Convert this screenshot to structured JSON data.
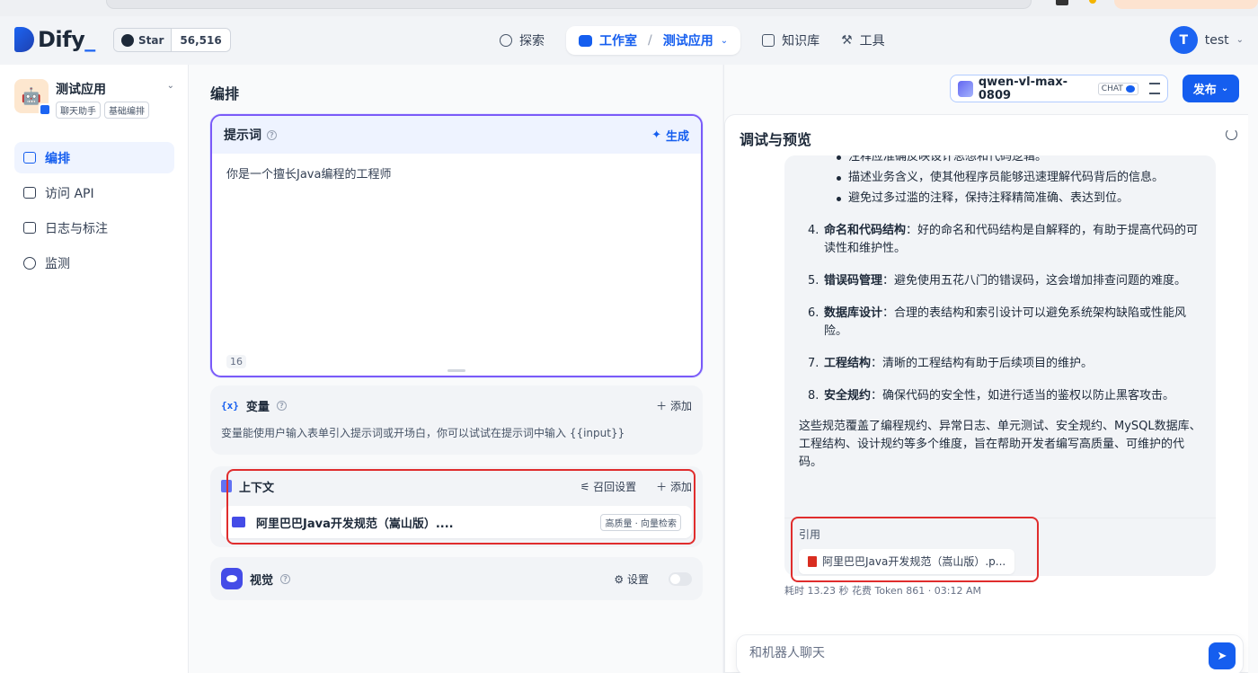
{
  "topnav": {
    "logo": "Dify",
    "github": {
      "star_label": "Star",
      "star_count": "56,516"
    },
    "nav": {
      "explore": "探索",
      "studio": "工作室",
      "current_app": "测试应用",
      "knowledge": "知识库",
      "tools": "工具"
    },
    "user": {
      "initial": "T",
      "name": "test"
    }
  },
  "sidebar": {
    "app": {
      "name": "测试应用",
      "tags": [
        "聊天助手",
        "基础编排"
      ]
    },
    "items": [
      {
        "label": "编排",
        "icon": "layout-icon",
        "active": true
      },
      {
        "label": "访问 API",
        "icon": "terminal-icon",
        "active": false
      },
      {
        "label": "日志与标注",
        "icon": "document-icon",
        "active": false
      },
      {
        "label": "监测",
        "icon": "monitor-icon",
        "active": false
      }
    ]
  },
  "orchestrate": {
    "title": "编排",
    "prompt": {
      "label": "提示词",
      "generate": "生成",
      "content": "你是一个擅长Java编程的工程师",
      "char_count": "16"
    },
    "variables": {
      "label": "变量",
      "add": "添加",
      "description": "变量能使用户输入表单引入提示词或开场白，你可以试试在提示词中输入 {{input}}"
    },
    "context": {
      "label": "上下文",
      "recall_settings": "召回设置",
      "add": "添加",
      "dataset_name": "阿里巴巴Java开发规范（嵩山版）....",
      "dataset_badge": "高质量 · 向量检索"
    },
    "vision": {
      "label": "视觉",
      "settings": "设置",
      "enabled": false
    }
  },
  "model": {
    "name": "qwen-vl-max-0809",
    "mode_badge": "CHAT"
  },
  "publish_label": "发布",
  "debug": {
    "title": "调试与预览",
    "bullets": [
      "注释应准确反映设计思想和代码逻辑。",
      "描述业务含义，使其他程序员能够迅速理解代码背后的信息。",
      "避免过多过滥的注释，保持注释精简准确、表达到位。"
    ],
    "items": [
      {
        "num": "4.",
        "title": "命名和代码结构",
        "text": "：好的命名和代码结构是自解释的，有助于提高代码的可读性和维护性。"
      },
      {
        "num": "5.",
        "title": "错误码管理",
        "text": "：避免使用五花八门的错误码，这会增加排查问题的难度。"
      },
      {
        "num": "6.",
        "title": "数据库设计",
        "text": "：合理的表结构和索引设计可以避免系统架构缺陷或性能风险。"
      },
      {
        "num": "7.",
        "title": "工程结构",
        "text": "：清晰的工程结构有助于后续项目的维护。"
      },
      {
        "num": "8.",
        "title": "安全规约",
        "text": "：确保代码的安全性，如进行适当的鉴权以防止黑客攻击。"
      }
    ],
    "summary": "这些规范覆盖了编程规约、异常日志、单元测试、安全规约、MySQL数据库、工程结构、设计规约等多个维度，旨在帮助开发者编写高质量、可维护的代码。",
    "citation_label": "引用",
    "citation_file": "阿里巴巴Java开发规范（嵩山版）.p...",
    "meta": "耗时 13.23 秒  花费 Token 861  ·  03:12 AM",
    "input_placeholder": "和机器人聊天"
  },
  "colors": {
    "accent": "#155eef",
    "prompt_border": "#7a5af8",
    "highlight_box": "#e02d2d"
  }
}
